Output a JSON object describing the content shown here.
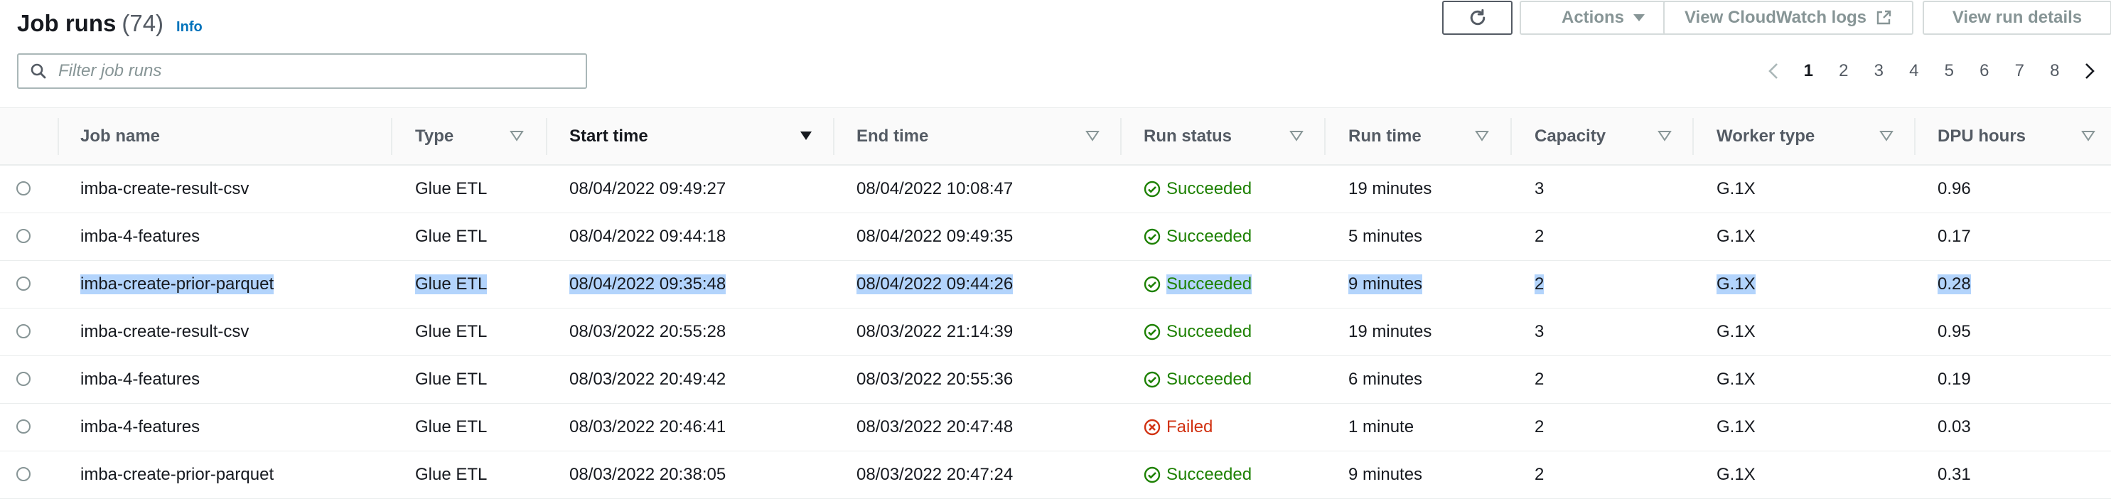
{
  "header": {
    "title": "Job runs",
    "count": "(74)",
    "info": "Info"
  },
  "toolbar": {
    "actions_label": "Actions",
    "cloudwatch_label": "View CloudWatch logs",
    "view_details_label": "View run details"
  },
  "search": {
    "placeholder": "Filter job runs",
    "value": ""
  },
  "pagination": {
    "current": "1",
    "pages": [
      "1",
      "2",
      "3",
      "4",
      "5",
      "6",
      "7",
      "8"
    ]
  },
  "table": {
    "columns": [
      "Job name",
      "Type",
      "Start time",
      "End time",
      "Run status",
      "Run time",
      "Capacity",
      "Worker type",
      "DPU hours"
    ],
    "rows": [
      {
        "name": "imba-create-result-csv",
        "type": "Glue ETL",
        "start": "08/04/2022 09:49:27",
        "end": "08/04/2022 10:08:47",
        "status": "Succeeded",
        "runtime": "19 minutes",
        "capacity": "3",
        "worker": "G.1X",
        "dpu": "0.96"
      },
      {
        "name": "imba-4-features",
        "type": "Glue ETL",
        "start": "08/04/2022 09:44:18",
        "end": "08/04/2022 09:49:35",
        "status": "Succeeded",
        "runtime": "5 minutes",
        "capacity": "2",
        "worker": "G.1X",
        "dpu": "0.17"
      },
      {
        "name": "imba-create-prior-parquet",
        "type": "Glue ETL",
        "start": "08/04/2022 09:35:48",
        "end": "08/04/2022 09:44:26",
        "status": "Succeeded",
        "runtime": "9 minutes",
        "capacity": "2",
        "worker": "G.1X",
        "dpu": "0.28"
      },
      {
        "name": "imba-create-result-csv",
        "type": "Glue ETL",
        "start": "08/03/2022 20:55:28",
        "end": "08/03/2022 21:14:39",
        "status": "Succeeded",
        "runtime": "19 minutes",
        "capacity": "3",
        "worker": "G.1X",
        "dpu": "0.95"
      },
      {
        "name": "imba-4-features",
        "type": "Glue ETL",
        "start": "08/03/2022 20:49:42",
        "end": "08/03/2022 20:55:36",
        "status": "Succeeded",
        "runtime": "6 minutes",
        "capacity": "2",
        "worker": "G.1X",
        "dpu": "0.19"
      },
      {
        "name": "imba-4-features",
        "type": "Glue ETL",
        "start": "08/03/2022 20:46:41",
        "end": "08/03/2022 20:47:48",
        "status": "Failed",
        "runtime": "1 minute",
        "capacity": "2",
        "worker": "G.1X",
        "dpu": "0.03"
      },
      {
        "name": "imba-create-prior-parquet",
        "type": "Glue ETL",
        "start": "08/03/2022 20:38:05",
        "end": "08/03/2022 20:47:24",
        "status": "Succeeded",
        "runtime": "9 minutes",
        "capacity": "2",
        "worker": "G.1X",
        "dpu": "0.31"
      }
    ]
  },
  "colors": {
    "success": "#1d8102",
    "failed": "#d13212",
    "link": "#0073bb",
    "selection": "#b3d4fc"
  },
  "icons": {
    "refresh": "refresh-icon",
    "search": "search-icon",
    "external": "external-link-icon",
    "sort": "sort-caret-icon"
  }
}
